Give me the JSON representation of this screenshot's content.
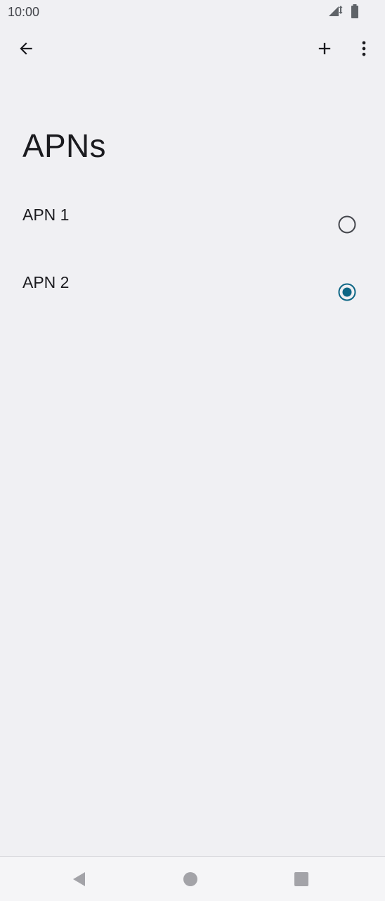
{
  "status_bar": {
    "time": "10:00",
    "icons": [
      "signal-icon",
      "battery-icon"
    ]
  },
  "toolbar": {
    "icons": [
      "back-arrow-icon",
      "add-icon",
      "more-vert-icon"
    ]
  },
  "page": {
    "title": "APNs"
  },
  "apns": [
    {
      "label": "APN 1",
      "selected": false
    },
    {
      "label": "APN 2",
      "selected": true
    }
  ],
  "colors": {
    "background": "#f0f0f3",
    "accent": "#0d6685",
    "radio_unselected": "#44464c",
    "text": "#1b1b1f"
  },
  "nav_bar": {
    "icons": [
      "nav-back-icon",
      "nav-home-icon",
      "nav-recents-icon"
    ]
  }
}
